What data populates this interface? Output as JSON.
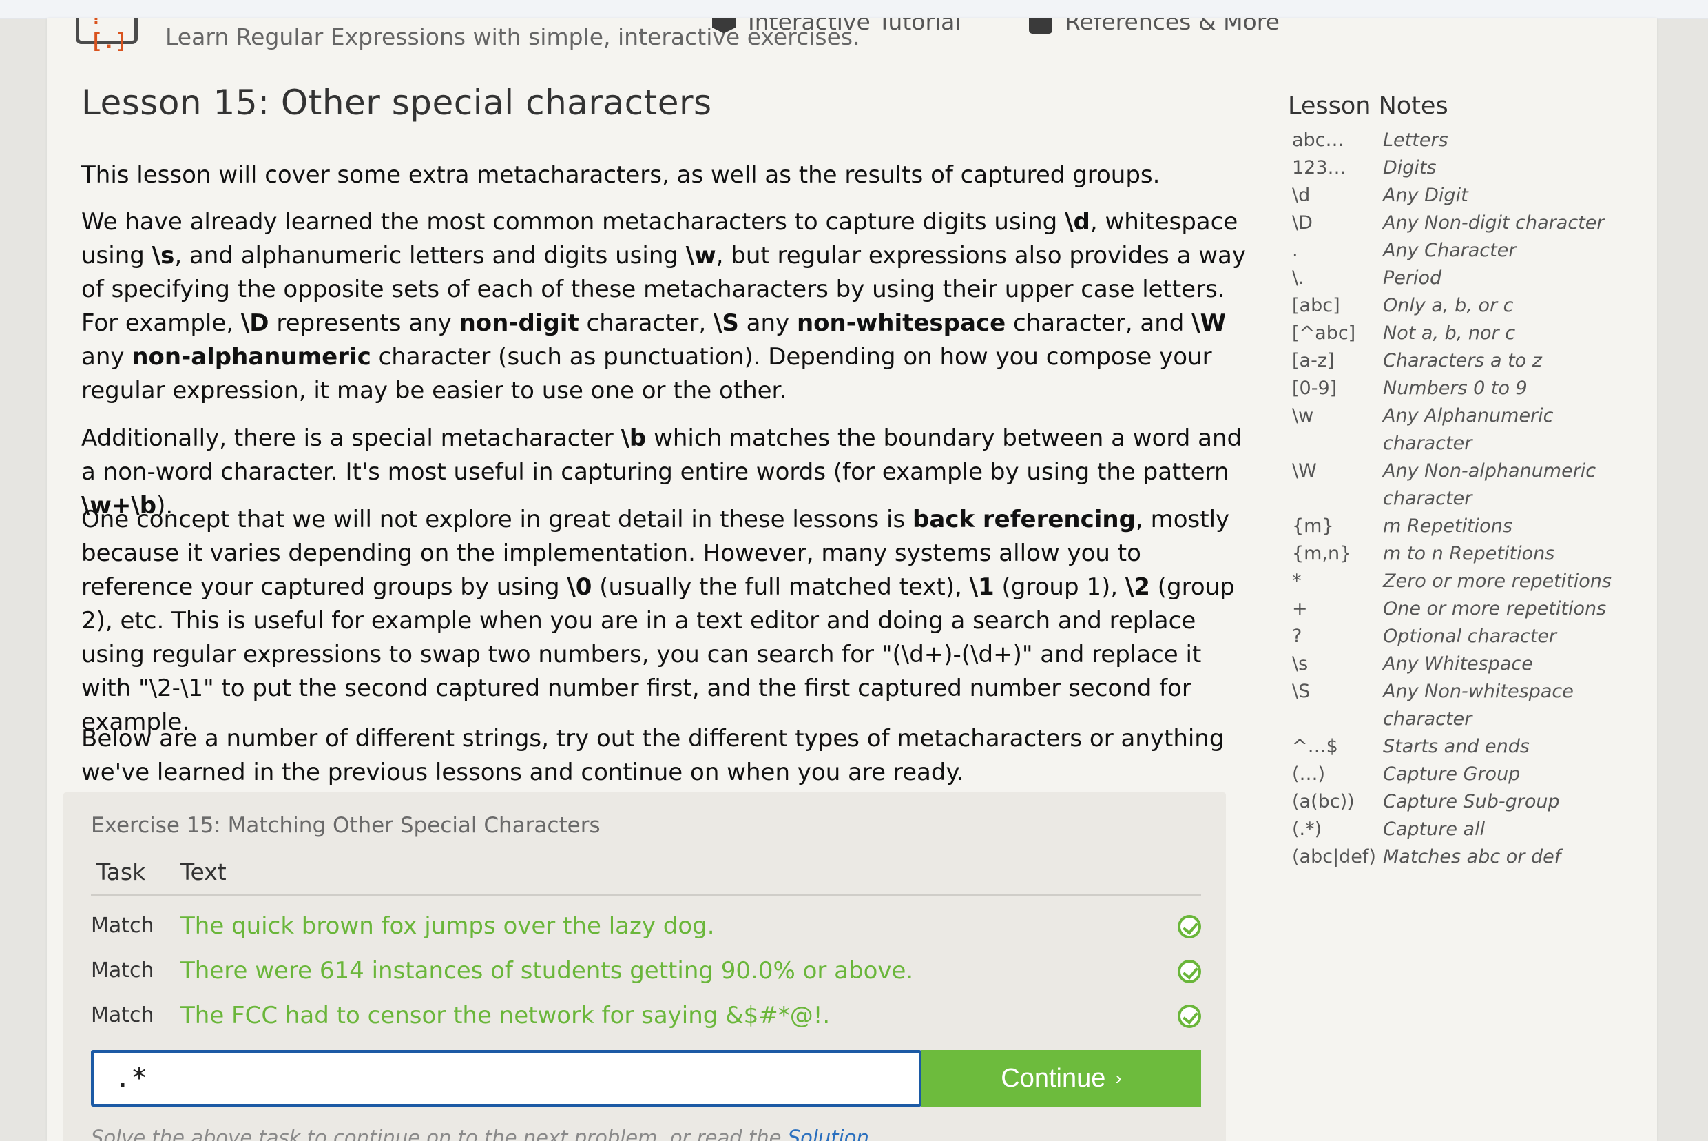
{
  "header": {
    "tagline": "Learn Regular Expressions with simple, interactive exercises.",
    "nav": [
      {
        "label": "Interactive Tutorial",
        "icon": "tutorial-icon"
      },
      {
        "label": "References & More",
        "icon": "book-icon"
      }
    ],
    "logo_mark": "?[.]"
  },
  "lesson": {
    "title": "Lesson 15: Other special characters",
    "p1": "This lesson will cover some extra metacharacters, as well as the results of captured groups.",
    "p2": {
      "a": "We have already learned the most common metacharacters to capture digits using ",
      "b": "\\d",
      "c": ", whitespace using ",
      "d": "\\s",
      "e": ", and alphanumeric letters and digits using ",
      "f": "\\w",
      "g": ", but regular expressions also provides a way of specifying the opposite sets of each of these metacharacters by using their upper case letters. For example, ",
      "h": "\\D",
      "i": " represents any ",
      "j": "non-digit",
      "k": " character, ",
      "l": "\\S",
      "m": " any ",
      "n": "non-whitespace",
      "o": " character, and ",
      "p": "\\W",
      "q": " any ",
      "r": "non-alphanumeric",
      "s": " character (such as punctuation). Depending on how you compose your regular expression, it may be easier to use one or the other."
    },
    "p3": {
      "a": "Additionally, there is a special metacharacter ",
      "b": "\\b",
      "c": " which matches the boundary between a word and a non-word character. It's most useful in capturing entire words (for example by using the pattern ",
      "d": "\\w+\\b",
      "e": ")."
    },
    "p4": {
      "a": "One concept that we will not explore in great detail in these lessons is ",
      "b": "back referencing",
      "c": ", mostly because it varies depending on the implementation. However, many systems allow you to reference your captured groups by using ",
      "d": "\\0",
      "e": " (usually the full matched text), ",
      "f": "\\1",
      "g": " (group 1), ",
      "h": "\\2",
      "i": " (group 2), etc. This is useful for example when you are in a text editor and doing a search and replace using regular expressions to swap two numbers, you can search for \"(\\d+)-(\\d+)\" and replace it with \"\\2-\\1\" to put the second captured number first, and the first captured number second for example."
    },
    "p5": "Below are a number of different strings, try out the different types of metacharacters or anything we've learned in the previous lessons and continue on when you are ready."
  },
  "notes": {
    "title": "Lesson Notes",
    "items": [
      {
        "k": "abc…",
        "v": "Letters"
      },
      {
        "k": "123…",
        "v": "Digits"
      },
      {
        "k": "\\d",
        "v": "Any Digit"
      },
      {
        "k": "\\D",
        "v": "Any Non-digit character"
      },
      {
        "k": ".",
        "v": "Any Character"
      },
      {
        "k": "\\.",
        "v": "Period"
      },
      {
        "k": "[abc]",
        "v": "Only a, b, or c"
      },
      {
        "k": "[^abc]",
        "v": "Not a, b, nor c"
      },
      {
        "k": "[a-z]",
        "v": "Characters a to z"
      },
      {
        "k": "[0-9]",
        "v": "Numbers 0 to 9"
      },
      {
        "k": "\\w",
        "v": "Any Alphanumeric character"
      },
      {
        "k": "\\W",
        "v": "Any Non-alphanumeric character"
      },
      {
        "k": "{m}",
        "v": "m Repetitions"
      },
      {
        "k": "{m,n}",
        "v": "m to n Repetitions"
      },
      {
        "k": "*",
        "v": "Zero or more repetitions"
      },
      {
        "k": "+",
        "v": "One or more repetitions"
      },
      {
        "k": "?",
        "v": "Optional character"
      },
      {
        "k": "\\s",
        "v": "Any Whitespace"
      },
      {
        "k": "\\S",
        "v": "Any Non-whitespace character"
      },
      {
        "k": "^…$",
        "v": "Starts and ends"
      },
      {
        "k": "(…)",
        "v": "Capture Group"
      },
      {
        "k": "(a(bc))",
        "v": "Capture Sub-group"
      },
      {
        "k": "(.*)",
        "v": "Capture all"
      },
      {
        "k": "(abc|def)",
        "v": "Matches abc or def"
      }
    ]
  },
  "exercise": {
    "title": "Exercise 15: Matching Other Special Characters",
    "col_task": "Task",
    "col_text": "Text",
    "rows": [
      {
        "task": "Match",
        "text": "The quick brown fox jumps over the lazy dog."
      },
      {
        "task": "Match",
        "text": "There were 614 instances of students getting 90.0% or above."
      },
      {
        "task": "Match",
        "text": "The FCC had to censor the network for saying &$#*@!."
      }
    ],
    "input_value": ".*",
    "continue_label": "Continue",
    "continue_chevron": "›",
    "hint_prefix": "Solve the above task to continue on to the next problem, or read the ",
    "hint_link": "Solution"
  },
  "colors": {
    "accent_green": "#6dbb3d",
    "input_border": "#1c5aa5",
    "link": "#2a6fbe"
  }
}
